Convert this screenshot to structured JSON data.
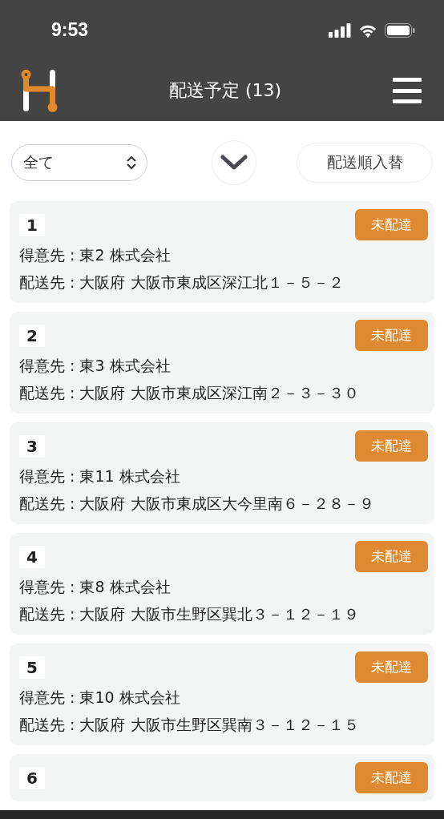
{
  "status_bar": {
    "time": "9:53"
  },
  "header": {
    "title": "配送予定 (13)"
  },
  "toolbar": {
    "filter": {
      "value": "全て"
    },
    "reorder_button": "配送順入替"
  },
  "deliveries": [
    {
      "number": "1",
      "status": "未配達",
      "customer": "得意先 : 東2 株式会社",
      "address": "配送先 : 大阪府 大阪市東成区深江北１－５－２"
    },
    {
      "number": "2",
      "status": "未配達",
      "customer": "得意先 : 東3 株式会社",
      "address": "配送先 : 大阪府 大阪市東成区深江南２－３－３０"
    },
    {
      "number": "3",
      "status": "未配達",
      "customer": "得意先 : 東11 株式会社",
      "address": "配送先 : 大阪府 大阪市東成区大今里南６－２８－９"
    },
    {
      "number": "4",
      "status": "未配達",
      "customer": "得意先 : 東8 株式会社",
      "address": "配送先 : 大阪府 大阪市生野区巽北３－１２－１９"
    },
    {
      "number": "5",
      "status": "未配達",
      "customer": "得意先 : 東10 株式会社",
      "address": "配送先 : 大阪府 大阪市生野区巽南３－１２－１５"
    },
    {
      "number": "6",
      "status": "未配達"
    }
  ]
}
